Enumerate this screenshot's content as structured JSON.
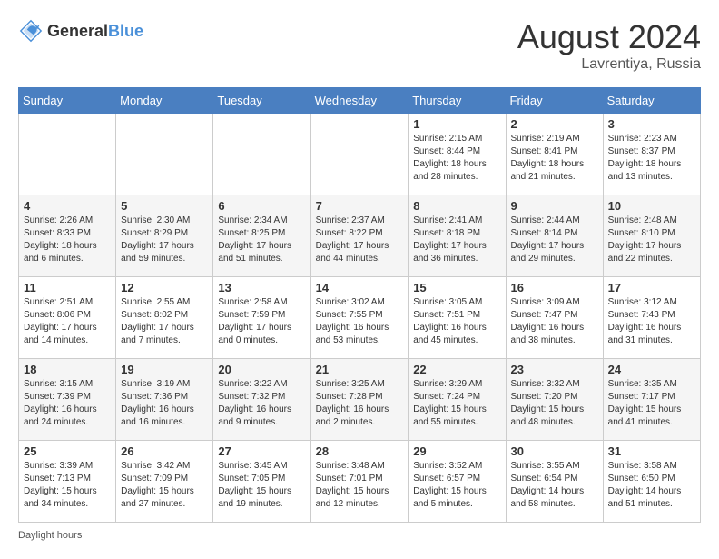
{
  "header": {
    "logo_general": "General",
    "logo_blue": "Blue",
    "month_year": "August 2024",
    "location": "Lavrentiya, Russia"
  },
  "days_of_week": [
    "Sunday",
    "Monday",
    "Tuesday",
    "Wednesday",
    "Thursday",
    "Friday",
    "Saturday"
  ],
  "weeks": [
    [
      {
        "day": "",
        "info": ""
      },
      {
        "day": "",
        "info": ""
      },
      {
        "day": "",
        "info": ""
      },
      {
        "day": "",
        "info": ""
      },
      {
        "day": "1",
        "info": "Sunrise: 2:15 AM\nSunset: 8:44 PM\nDaylight: 18 hours and 28 minutes."
      },
      {
        "day": "2",
        "info": "Sunrise: 2:19 AM\nSunset: 8:41 PM\nDaylight: 18 hours and 21 minutes."
      },
      {
        "day": "3",
        "info": "Sunrise: 2:23 AM\nSunset: 8:37 PM\nDaylight: 18 hours and 13 minutes."
      }
    ],
    [
      {
        "day": "4",
        "info": "Sunrise: 2:26 AM\nSunset: 8:33 PM\nDaylight: 18 hours and 6 minutes."
      },
      {
        "day": "5",
        "info": "Sunrise: 2:30 AM\nSunset: 8:29 PM\nDaylight: 17 hours and 59 minutes."
      },
      {
        "day": "6",
        "info": "Sunrise: 2:34 AM\nSunset: 8:25 PM\nDaylight: 17 hours and 51 minutes."
      },
      {
        "day": "7",
        "info": "Sunrise: 2:37 AM\nSunset: 8:22 PM\nDaylight: 17 hours and 44 minutes."
      },
      {
        "day": "8",
        "info": "Sunrise: 2:41 AM\nSunset: 8:18 PM\nDaylight: 17 hours and 36 minutes."
      },
      {
        "day": "9",
        "info": "Sunrise: 2:44 AM\nSunset: 8:14 PM\nDaylight: 17 hours and 29 minutes."
      },
      {
        "day": "10",
        "info": "Sunrise: 2:48 AM\nSunset: 8:10 PM\nDaylight: 17 hours and 22 minutes."
      }
    ],
    [
      {
        "day": "11",
        "info": "Sunrise: 2:51 AM\nSunset: 8:06 PM\nDaylight: 17 hours and 14 minutes."
      },
      {
        "day": "12",
        "info": "Sunrise: 2:55 AM\nSunset: 8:02 PM\nDaylight: 17 hours and 7 minutes."
      },
      {
        "day": "13",
        "info": "Sunrise: 2:58 AM\nSunset: 7:59 PM\nDaylight: 17 hours and 0 minutes."
      },
      {
        "day": "14",
        "info": "Sunrise: 3:02 AM\nSunset: 7:55 PM\nDaylight: 16 hours and 53 minutes."
      },
      {
        "day": "15",
        "info": "Sunrise: 3:05 AM\nSunset: 7:51 PM\nDaylight: 16 hours and 45 minutes."
      },
      {
        "day": "16",
        "info": "Sunrise: 3:09 AM\nSunset: 7:47 PM\nDaylight: 16 hours and 38 minutes."
      },
      {
        "day": "17",
        "info": "Sunrise: 3:12 AM\nSunset: 7:43 PM\nDaylight: 16 hours and 31 minutes."
      }
    ],
    [
      {
        "day": "18",
        "info": "Sunrise: 3:15 AM\nSunset: 7:39 PM\nDaylight: 16 hours and 24 minutes."
      },
      {
        "day": "19",
        "info": "Sunrise: 3:19 AM\nSunset: 7:36 PM\nDaylight: 16 hours and 16 minutes."
      },
      {
        "day": "20",
        "info": "Sunrise: 3:22 AM\nSunset: 7:32 PM\nDaylight: 16 hours and 9 minutes."
      },
      {
        "day": "21",
        "info": "Sunrise: 3:25 AM\nSunset: 7:28 PM\nDaylight: 16 hours and 2 minutes."
      },
      {
        "day": "22",
        "info": "Sunrise: 3:29 AM\nSunset: 7:24 PM\nDaylight: 15 hours and 55 minutes."
      },
      {
        "day": "23",
        "info": "Sunrise: 3:32 AM\nSunset: 7:20 PM\nDaylight: 15 hours and 48 minutes."
      },
      {
        "day": "24",
        "info": "Sunrise: 3:35 AM\nSunset: 7:17 PM\nDaylight: 15 hours and 41 minutes."
      }
    ],
    [
      {
        "day": "25",
        "info": "Sunrise: 3:39 AM\nSunset: 7:13 PM\nDaylight: 15 hours and 34 minutes."
      },
      {
        "day": "26",
        "info": "Sunrise: 3:42 AM\nSunset: 7:09 PM\nDaylight: 15 hours and 27 minutes."
      },
      {
        "day": "27",
        "info": "Sunrise: 3:45 AM\nSunset: 7:05 PM\nDaylight: 15 hours and 19 minutes."
      },
      {
        "day": "28",
        "info": "Sunrise: 3:48 AM\nSunset: 7:01 PM\nDaylight: 15 hours and 12 minutes."
      },
      {
        "day": "29",
        "info": "Sunrise: 3:52 AM\nSunset: 6:57 PM\nDaylight: 15 hours and 5 minutes."
      },
      {
        "day": "30",
        "info": "Sunrise: 3:55 AM\nSunset: 6:54 PM\nDaylight: 14 hours and 58 minutes."
      },
      {
        "day": "31",
        "info": "Sunrise: 3:58 AM\nSunset: 6:50 PM\nDaylight: 14 hours and 51 minutes."
      }
    ]
  ],
  "footer": {
    "note": "Daylight hours"
  }
}
